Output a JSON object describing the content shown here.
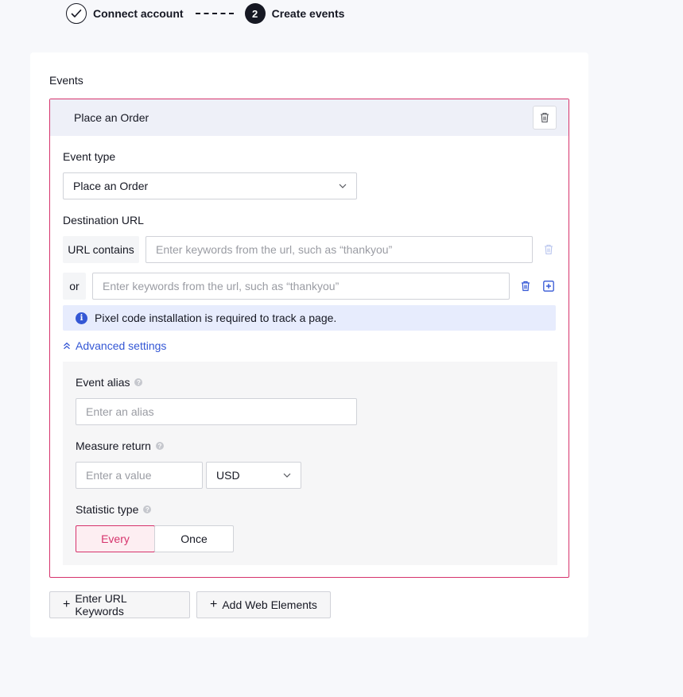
{
  "stepper": {
    "steps": [
      {
        "number": "",
        "label": "Connect account",
        "state": "done"
      },
      {
        "number": "2",
        "label": "Create events",
        "state": "active"
      }
    ]
  },
  "card": {
    "section_title": "Events",
    "event": {
      "header_title": "Place an Order",
      "event_type_label": "Event type",
      "event_type_value": "Place an Order",
      "destination_url_label": "Destination URL",
      "url_rule_1": {
        "prefix": "URL contains",
        "placeholder": "Enter keywords from the url, such as “thankyou”"
      },
      "url_rule_2": {
        "prefix": "or",
        "placeholder": "Enter keywords from the url, such as “thankyou”"
      },
      "info_text": "Pixel code installation is required to track a page.",
      "advanced_link": "Advanced settings",
      "advanced": {
        "alias_label": "Event alias",
        "alias_placeholder": "Enter an alias",
        "measure_label": "Measure return",
        "measure_placeholder": "Enter a value",
        "currency_value": "USD",
        "statistic_label": "Statistic type",
        "statistic_options": [
          "Every",
          "Once"
        ],
        "statistic_selected": "Every"
      }
    },
    "actions": {
      "enter_url_keywords": "Enter URL Keywords",
      "add_web_elements": "Add Web Elements"
    }
  },
  "colors": {
    "accent": "#d6336c",
    "link": "#3457d5",
    "info_bg": "#e7ecfd"
  }
}
